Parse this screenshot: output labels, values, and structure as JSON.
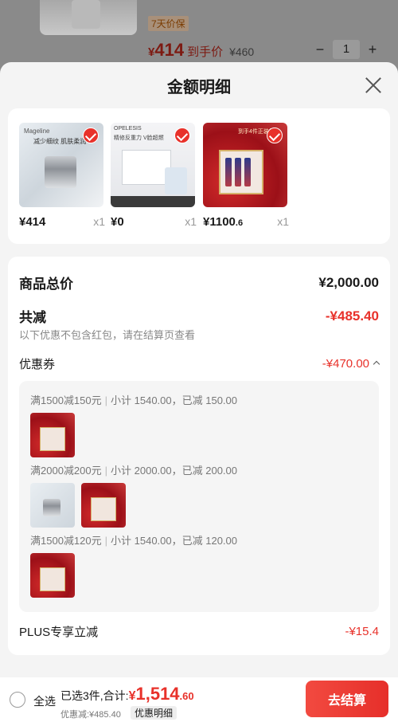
{
  "background": {
    "tag": "7天价保",
    "price_yen": "¥",
    "price_num": "414",
    "price_label": "到手价",
    "orig_price": "¥460",
    "minus": "−",
    "qty": "1",
    "plus": "+"
  },
  "sheet": {
    "title": "金额明细",
    "close_icon": "close-icon"
  },
  "products": [
    {
      "price": "¥414",
      "price_small": "",
      "qty": "x1",
      "brand": "Mageline",
      "text": "减少细纹 肌肤柔润",
      "icon": "product-image"
    },
    {
      "price": "¥0",
      "price_small": "",
      "qty": "x1",
      "brand": "OPELESIS",
      "text": "精修反重力 V脸超燃",
      "icon": "product-image"
    },
    {
      "price": "¥1100",
      "price_small": ".6",
      "qty": "x1",
      "brand": "",
      "text": "到手4件正装量",
      "icon": "product-image"
    }
  ],
  "detail": {
    "total_label": "商品总价",
    "total_value": "¥2,000.00",
    "discount_label": "共减",
    "discount_value": "-¥485.40",
    "discount_note": "以下优惠不包含红包，请在结算页查看",
    "coupon_label": "优惠券",
    "coupon_value": "-¥470.00",
    "coupons": [
      {
        "rule": "满1500减150元",
        "subtotal": "小计 1540.00，已减 150.00"
      },
      {
        "rule": "满2000减200元",
        "subtotal": "小计 2000.00，已减 200.00"
      },
      {
        "rule": "满1500减120元",
        "subtotal": "小计 1540.00，已减 120.00"
      }
    ],
    "plus_label": "PLUS专享立减",
    "plus_value": "-¥15.4"
  },
  "bottom": {
    "select_all": "全选",
    "summary_prefix": "已选3件,合计:",
    "total_yen": "¥",
    "total_big": "1,514",
    "total_dec": ".60",
    "saving": "优惠减:¥485.40",
    "detail_chip": "优惠明细",
    "checkout": "去结算"
  },
  "colors": {
    "accent": "#e8312a",
    "sheet_bg": "#f4f4f4",
    "card_bg": "#ffffff"
  }
}
